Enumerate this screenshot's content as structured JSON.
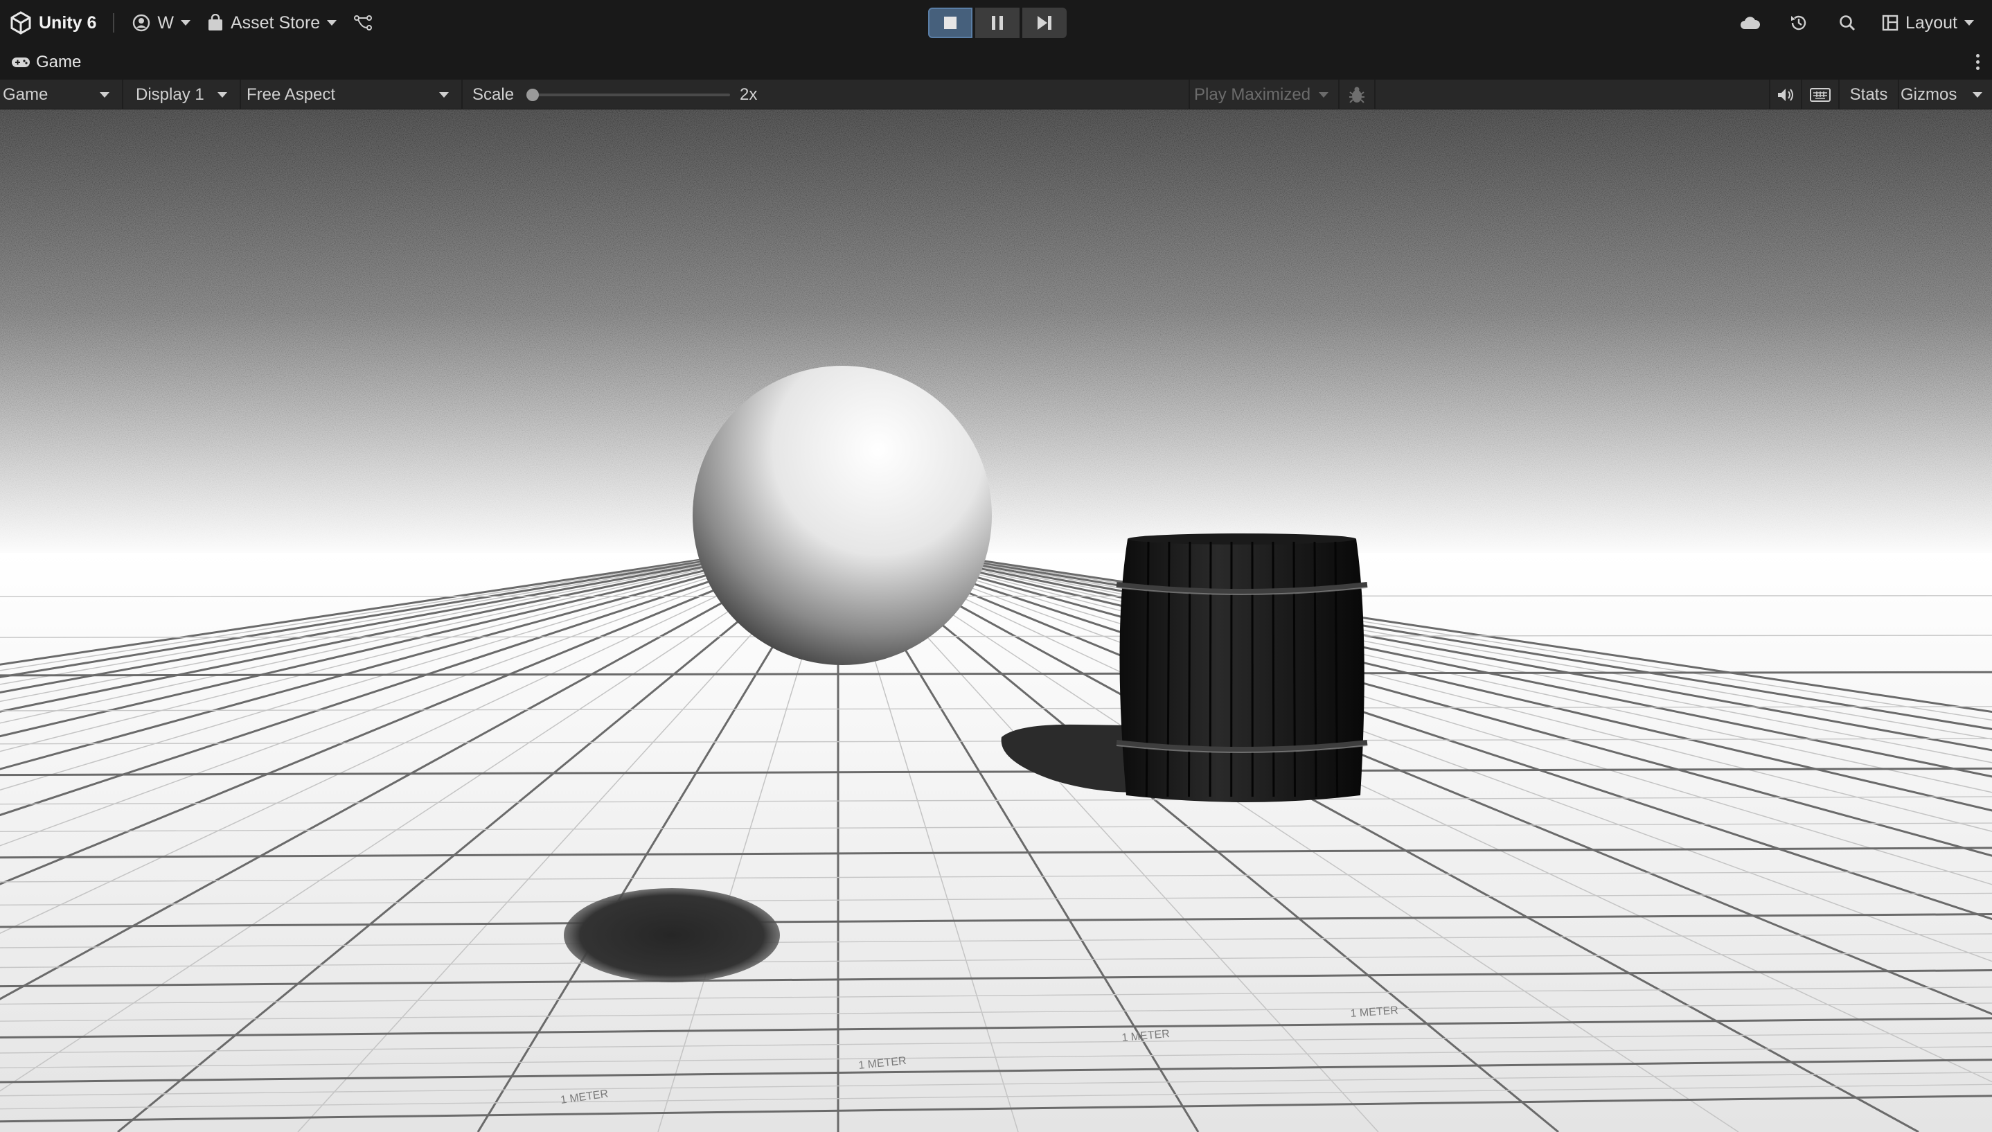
{
  "toolbar": {
    "brand": "Unity 6",
    "account_label": "W",
    "asset_store_label": "Asset Store",
    "layout_label": "Layout",
    "accent": "#5a7ea6"
  },
  "tab": {
    "label": "Game"
  },
  "gamebar": {
    "view_mode": "Game",
    "display": "Display 1",
    "aspect": "Free Aspect",
    "scale_label": "Scale",
    "scale_value": "2x",
    "play_mode": "Play Maximized",
    "stats_label": "Stats",
    "gizmos_label": "Gizmos"
  },
  "scene": {
    "grid_label": "1 METER"
  }
}
